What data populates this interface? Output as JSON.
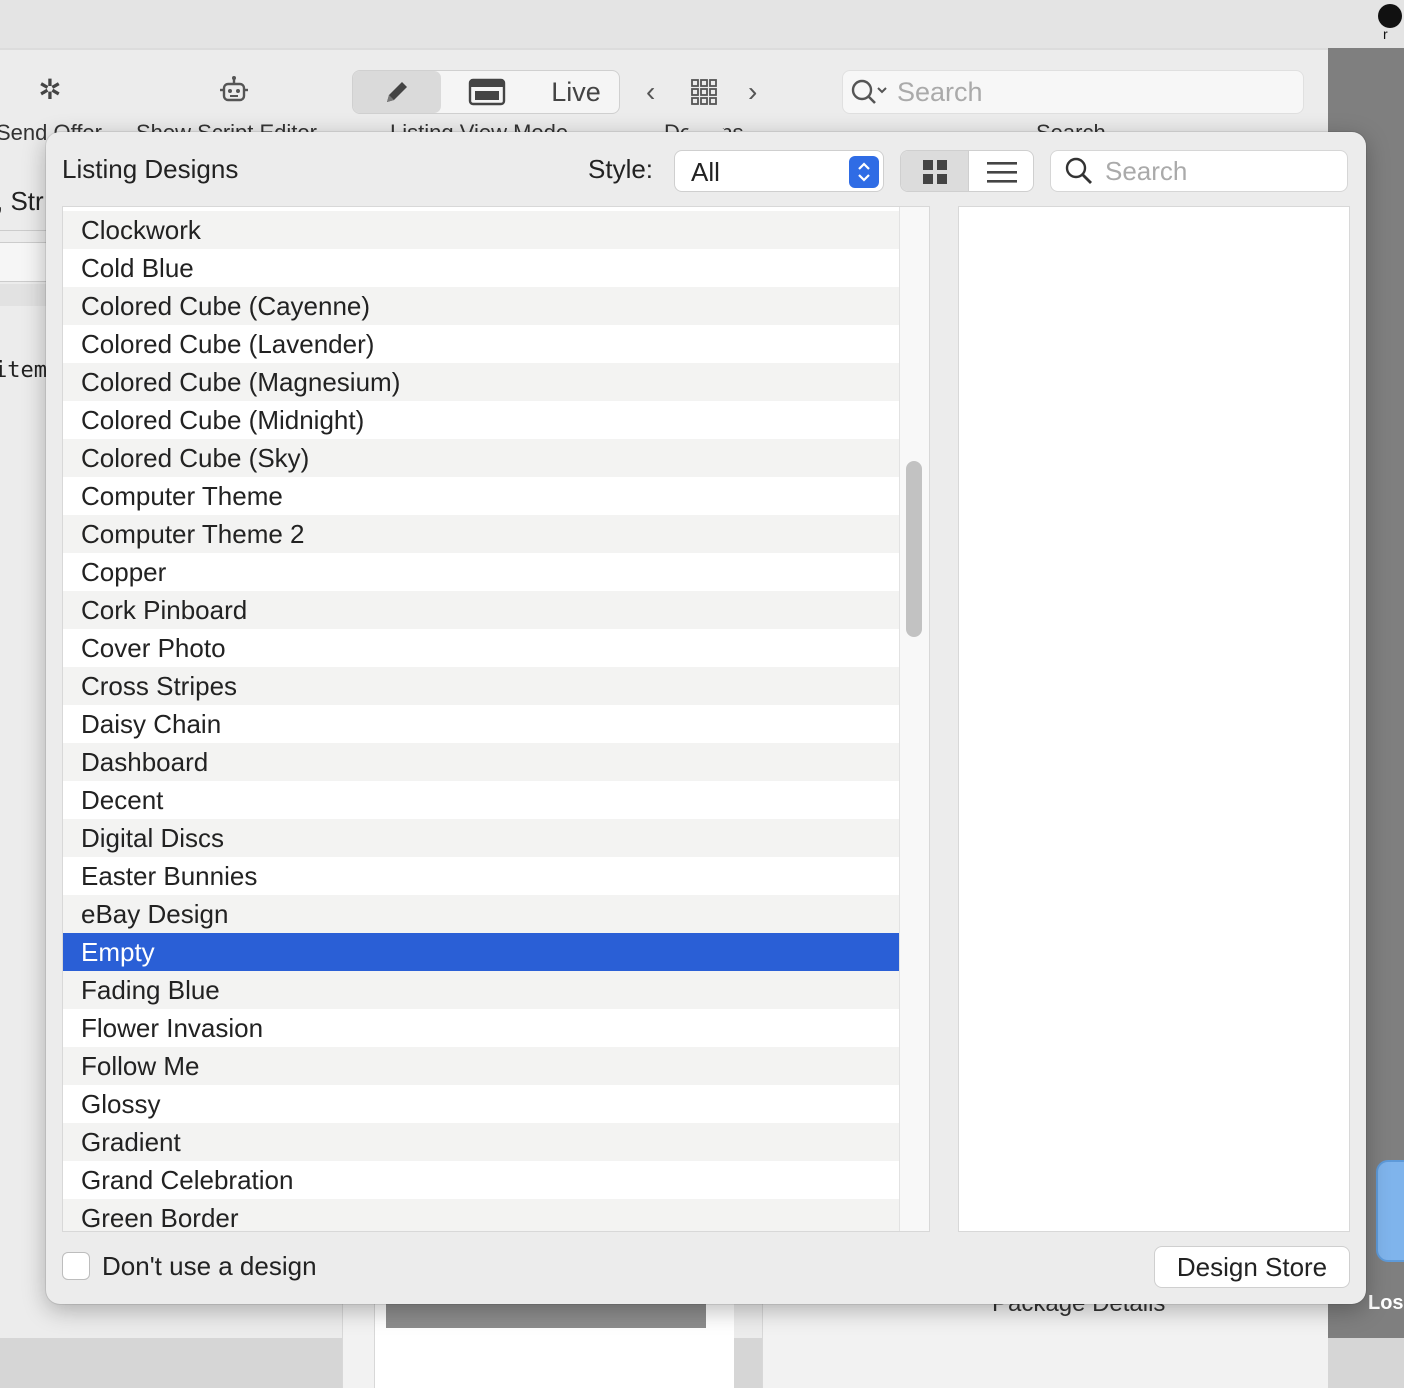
{
  "desktop": {
    "menubar_indicator_label": "r",
    "right_fragment_text": "Los"
  },
  "toolbar": {
    "send_offer_label": "Send Offer",
    "show_script_editor_label": "Show Script Editor",
    "listing_view_mode_label": "Listing View Mode",
    "designs_label": "Designs",
    "search_label": "Search",
    "live_label": "Live",
    "search_placeholder": "Search"
  },
  "background": {
    "left_text_1": ", Str",
    "left_text_2": "item",
    "bottom_text": "Package Details"
  },
  "popover": {
    "title": "Listing Designs",
    "style_label": "Style:",
    "style_value": "All",
    "search_placeholder": "Search",
    "items": [
      "Clockwork",
      "Cold Blue",
      "Colored Cube (Cayenne)",
      "Colored Cube (Lavender)",
      "Colored Cube (Magnesium)",
      "Colored Cube (Midnight)",
      "Colored Cube (Sky)",
      "Computer Theme",
      "Computer Theme 2",
      "Copper",
      "Cork Pinboard",
      "Cover Photo",
      "Cross Stripes",
      "Daisy Chain",
      "Dashboard",
      "Decent",
      "Digital Discs",
      "Easter Bunnies",
      "eBay Design",
      "Empty",
      "Fading Blue",
      "Flower Invasion",
      "Follow Me",
      "Glossy",
      "Gradient",
      "Grand Celebration",
      "Green Border"
    ],
    "selected_item": "Empty",
    "dont_use_design_label": "Don't use a design",
    "dont_use_design_checked": false,
    "design_store_label": "Design Store"
  },
  "colors": {
    "selection": "#2a5fd6",
    "stepper": "#2f6ce5"
  }
}
